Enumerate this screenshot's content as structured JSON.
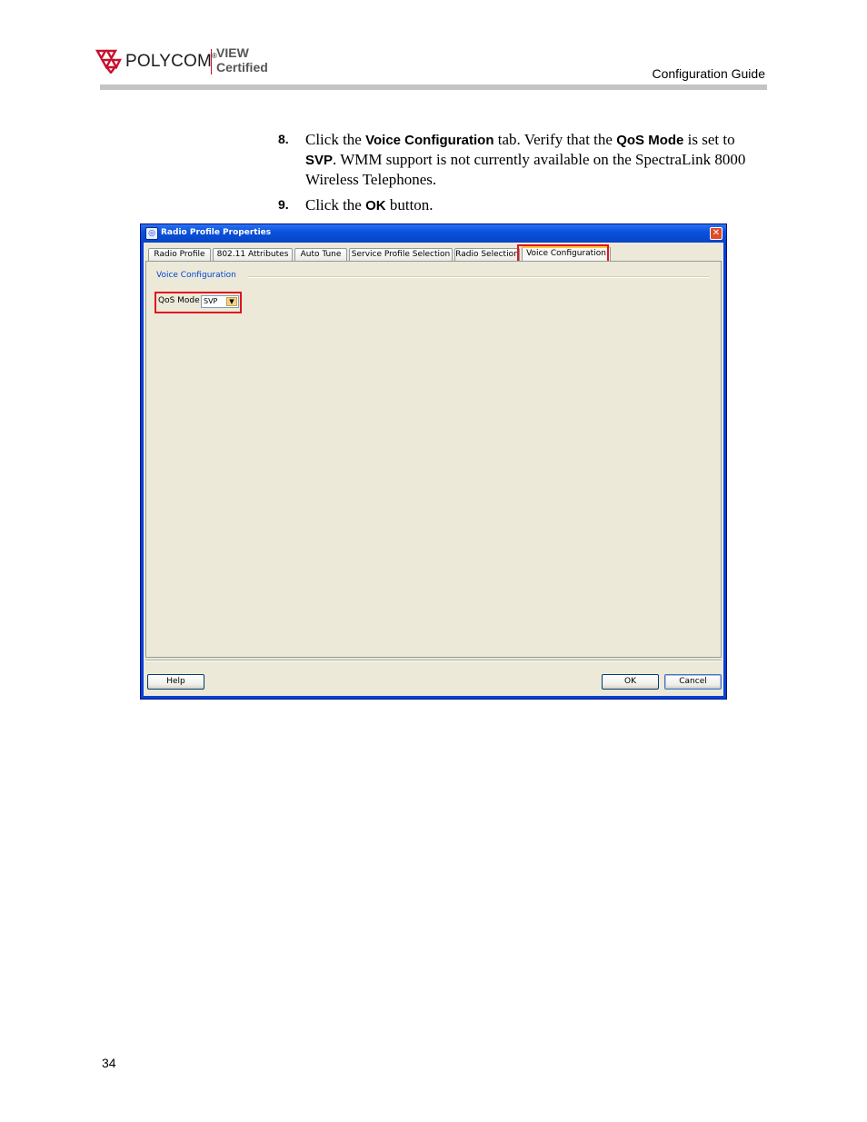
{
  "header": {
    "brand": "POLYCOM",
    "brand_mark": "®",
    "badge_line1": "VIEW",
    "badge_line2": "Certified",
    "title": "Configuration Guide"
  },
  "steps": [
    {
      "number": "8.",
      "parts": [
        "Click the ",
        "Voice Configuration",
        " tab. Verify that the ",
        "QoS Mode",
        " is set to ",
        "SVP",
        ". WMM support is not currently available on the SpectraLink 8000 Wireless Telephones."
      ]
    },
    {
      "number": "9.",
      "parts": [
        "Click the ",
        "OK",
        " button."
      ]
    }
  ],
  "dialog": {
    "title": "Radio Profile Properties",
    "tabs": [
      "Radio Profile",
      "802.11 Attributes",
      "Auto Tune",
      "Service Profile Selection",
      "Radio Selection",
      "Voice Configuration"
    ],
    "active_tab": "Voice Configuration",
    "section_label": "Voice Configuration",
    "qos_label": "QoS Mode",
    "qos_value": "SVP",
    "buttons": {
      "help": "Help",
      "ok": "OK",
      "cancel": "Cancel"
    }
  },
  "page_number": "34",
  "colors": {
    "highlight": "#e0141e",
    "titlebar": "#0a52dc",
    "dialog_bg": "#ece9d8",
    "logo_red": "#c8102e"
  }
}
